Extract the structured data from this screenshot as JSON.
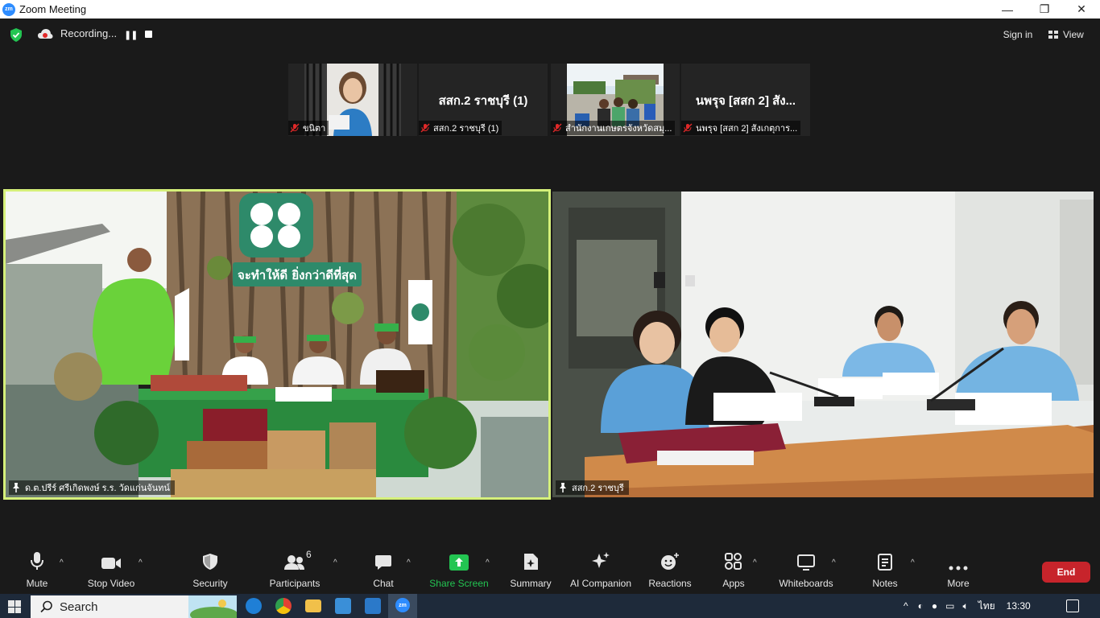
{
  "window": {
    "title": "Zoom Meeting",
    "logo_text": "zm"
  },
  "window_controls": {
    "minimize": "—",
    "maximize": "❐",
    "close": "✕"
  },
  "topbar": {
    "recording_label": "Recording...",
    "signin_label": "Sign in",
    "view_label": "View"
  },
  "thumbnails": [
    {
      "name": "ขนิตา",
      "muted": true,
      "has_video": true
    },
    {
      "name": "สสก.2 ราชบุรี (1)",
      "big_name": "สสก.2 ราชบุรี (1)",
      "muted": true,
      "has_video": false
    },
    {
      "name": "สำนักงานเกษตรจังหวัดสมุ...",
      "muted": true,
      "has_video": true
    },
    {
      "name": "นพรุจ [สสก 2] สังเกตุการ...",
      "big_name": "นพรุจ [สสก 2] สัง...",
      "muted": true,
      "has_video": false
    }
  ],
  "main_tiles": [
    {
      "name": "ด.ต.ปรีร์ ศรีเกิดพงษ์ ร.ร. วัดแก่นจันทน์",
      "sign_text": "จะทำให้ดี ยิ่งกว่าดีที่สุด",
      "active_speaker": true
    },
    {
      "name": "สสก.2 ราชบุรี",
      "active_speaker": false
    }
  ],
  "toolbar": {
    "mute": "Mute",
    "stop_video": "Stop Video",
    "security": "Security",
    "participants": "Participants",
    "participants_count": "6",
    "chat": "Chat",
    "share_screen": "Share Screen",
    "summary": "Summary",
    "ai_companion": "AI Companion",
    "reactions": "Reactions",
    "apps": "Apps",
    "whiteboards": "Whiteboards",
    "notes": "Notes",
    "more": "More",
    "end": "End"
  },
  "taskbar": {
    "search_label": "Search",
    "language": "ไทย",
    "time": "13:30"
  },
  "colors": {
    "active_border": "#d5f07a",
    "share_green": "#23c552",
    "end_red": "#c7242b",
    "zoom_blue": "#2d8cff"
  }
}
